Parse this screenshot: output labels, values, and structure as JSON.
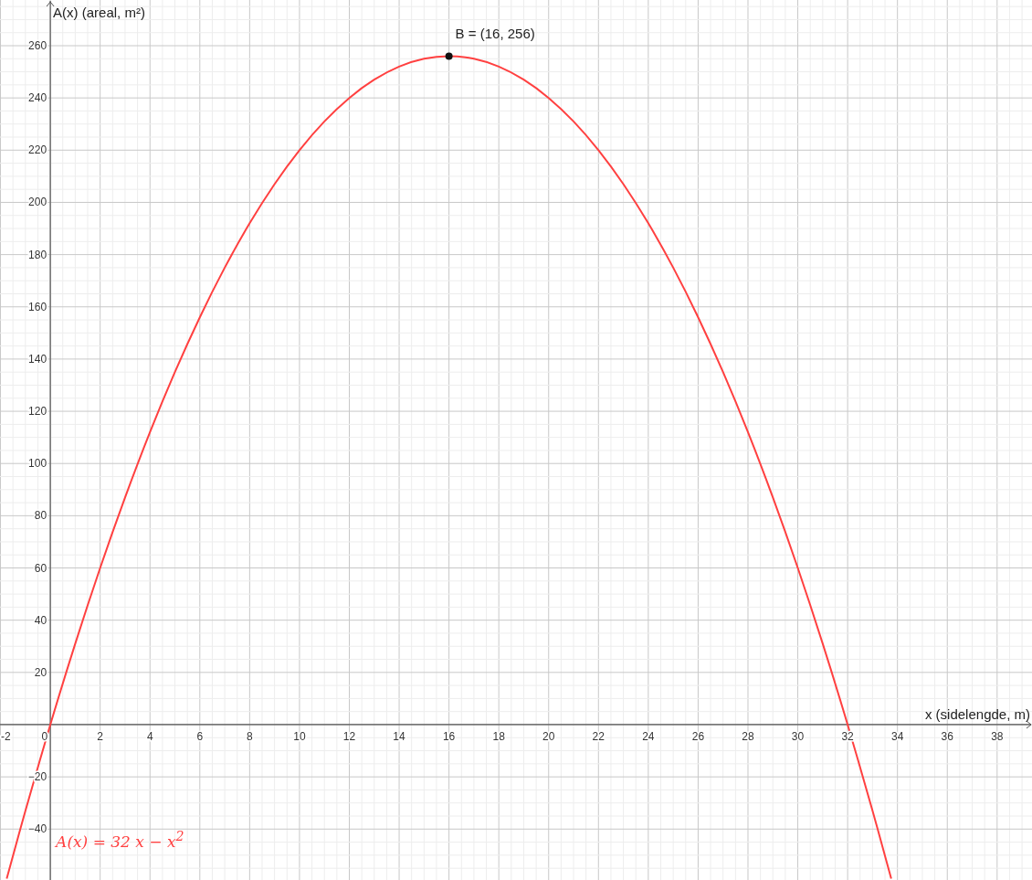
{
  "graph": {
    "chart_data": {
      "type": "line",
      "xlabel": "x (sidelengde, m)",
      "ylabel": "A(x) (areal, m²)",
      "x": [
        -1.75,
        -1,
        0,
        1,
        2,
        3,
        4,
        5,
        6,
        7,
        8,
        9,
        10,
        11,
        12,
        13,
        14,
        15,
        16,
        17,
        18,
        19,
        20,
        21,
        22,
        23,
        24,
        25,
        26,
        27,
        28,
        29,
        30,
        31,
        32,
        33,
        33.75
      ],
      "series": [
        {
          "name": "*A*(*x*) = 32 *x* − *x*$^{2}$",
          "color": "#ff4040",
          "values": [
            -59,
            -33,
            0,
            31,
            60,
            87,
            112,
            135,
            156,
            175,
            192,
            207,
            220,
            231,
            240,
            247,
            252,
            255,
            256,
            255,
            252,
            247,
            240,
            231,
            220,
            207,
            192,
            175,
            156,
            135,
            112,
            87,
            60,
            31,
            0,
            -33,
            -59
          ]
        }
      ],
      "xlim": [
        -2.02,
        39.4
      ],
      "ylim": [
        -59.5,
        277.5
      ],
      "xticks": [
        -2,
        0,
        2,
        4,
        6,
        8,
        10,
        12,
        14,
        16,
        18,
        20,
        22,
        24,
        26,
        28,
        30,
        32,
        34,
        36,
        38
      ],
      "yticks": [
        {
          "value": -40,
          "label": "−40"
        },
        {
          "value": -20,
          "label": "−20"
        },
        20,
        40,
        60,
        80,
        100,
        120,
        140,
        160,
        180,
        200,
        220,
        240,
        260
      ],
      "grid": true,
      "annotations": [
        {
          "x": 16,
          "y": 256,
          "text": "B = (16, 256)"
        }
      ]
    }
  }
}
